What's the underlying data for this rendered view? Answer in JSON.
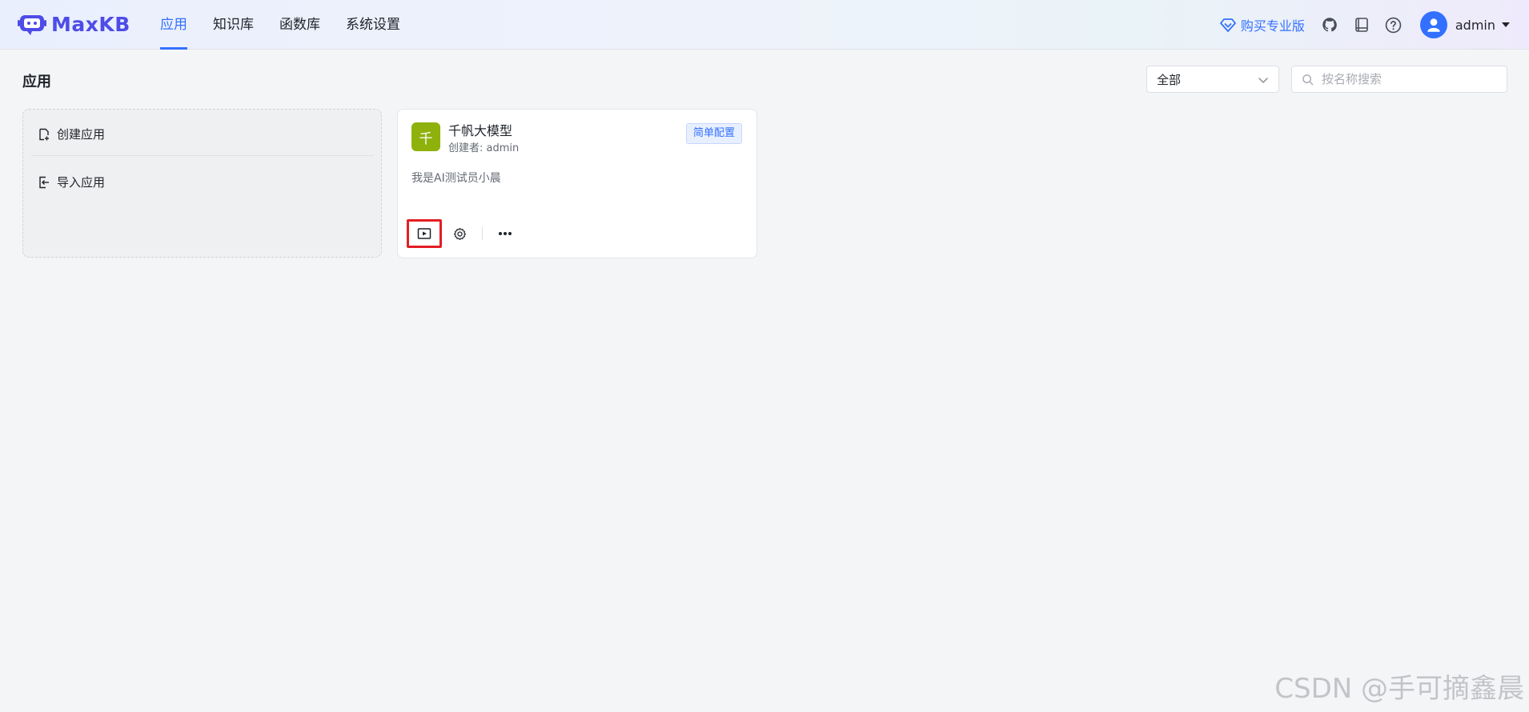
{
  "brand": {
    "name": "MaxKB"
  },
  "nav": {
    "items": [
      {
        "label": "应用",
        "active": true
      },
      {
        "label": "知识库",
        "active": false
      },
      {
        "label": "函数库",
        "active": false
      },
      {
        "label": "系统设置",
        "active": false
      }
    ]
  },
  "header": {
    "buy_label": "购买专业版",
    "user": "admin",
    "icons": [
      "github-icon",
      "book-icon",
      "help-icon",
      "user-avatar-icon"
    ]
  },
  "toolbar": {
    "title": "应用",
    "filter_value": "全部",
    "search_placeholder": "按名称搜索"
  },
  "create_panel": {
    "create_label": "创建应用",
    "import_label": "导入应用"
  },
  "apps": [
    {
      "avatar_letter": "千",
      "avatar_color": "#8fb10c",
      "name": "千帆大模型",
      "creator": "创建者: admin",
      "tag": "简单配置",
      "description": "我是AI测试员小晨"
    }
  ],
  "watermark": "CSDN @手可摘鑫晨",
  "colors": {
    "accent": "#3370ff",
    "highlight": "#e31e24",
    "brand": "#4e4ce8"
  }
}
